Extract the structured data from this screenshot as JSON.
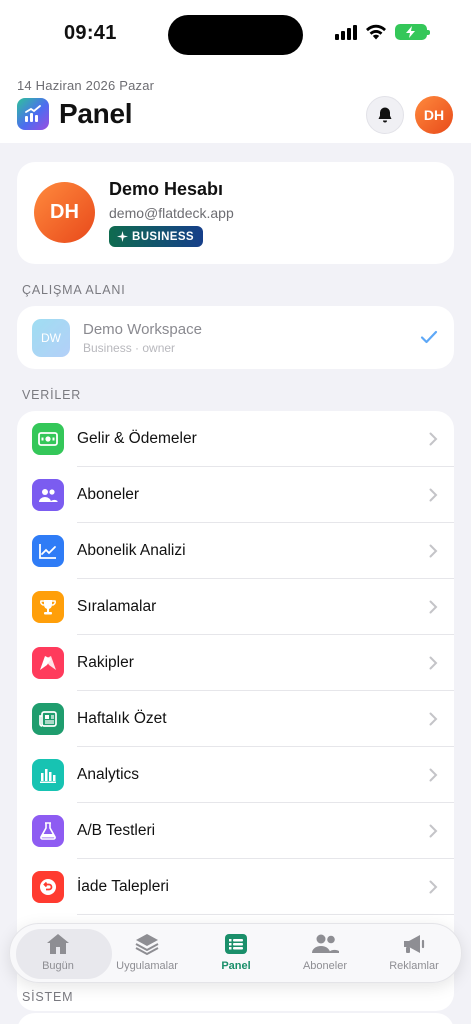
{
  "status_bar": {
    "time": "09:41"
  },
  "header": {
    "date": "14 Haziran 2026 Pazar",
    "title": "Panel",
    "avatar_initials": "DH"
  },
  "profile": {
    "initials": "DH",
    "name": "Demo Hesabı",
    "email": "demo@flatdeck.app",
    "plan": "BUSINESS"
  },
  "workspace_section": {
    "label": "ÇALIŞMA ALANI",
    "workspace": {
      "initials": "DW",
      "name": "Demo Workspace",
      "subtitle": "Business · owner"
    }
  },
  "data_section": {
    "label": "VERİLER",
    "items": [
      {
        "label": "Gelir & Ödemeler",
        "icon": "cash-icon",
        "color": "#34c759"
      },
      {
        "label": "Aboneler",
        "icon": "people-icon",
        "color": "#7b5cf0"
      },
      {
        "label": "Abonelik Analizi",
        "icon": "chart-line-icon",
        "color": "#2f7cf6"
      },
      {
        "label": "Sıralamalar",
        "icon": "trophy-icon",
        "color": "#ff9f0a"
      },
      {
        "label": "Rakipler",
        "icon": "flags-icon",
        "color": "#ff3b5c"
      },
      {
        "label": "Haftalık Özet",
        "icon": "newspaper-icon",
        "color": "#1f9d6e"
      },
      {
        "label": "Analytics",
        "icon": "bar-chart-icon",
        "color": "#17c3b2"
      },
      {
        "label": "A/B Testleri",
        "icon": "flask-icon",
        "color": "#8e5cf2"
      },
      {
        "label": "İade Talepleri",
        "icon": "refund-icon",
        "color": "#ff3b30"
      }
    ]
  },
  "system_section": {
    "label": "SİSTEM"
  },
  "tab_bar": {
    "tabs": [
      {
        "label": "Bugün",
        "icon": "home-icon"
      },
      {
        "label": "Uygulamalar",
        "icon": "layers-icon"
      },
      {
        "label": "Panel",
        "icon": "panel-list-icon",
        "active": true
      },
      {
        "label": "Aboneler",
        "icon": "people-icon"
      },
      {
        "label": "Reklamlar",
        "icon": "megaphone-icon"
      }
    ]
  }
}
